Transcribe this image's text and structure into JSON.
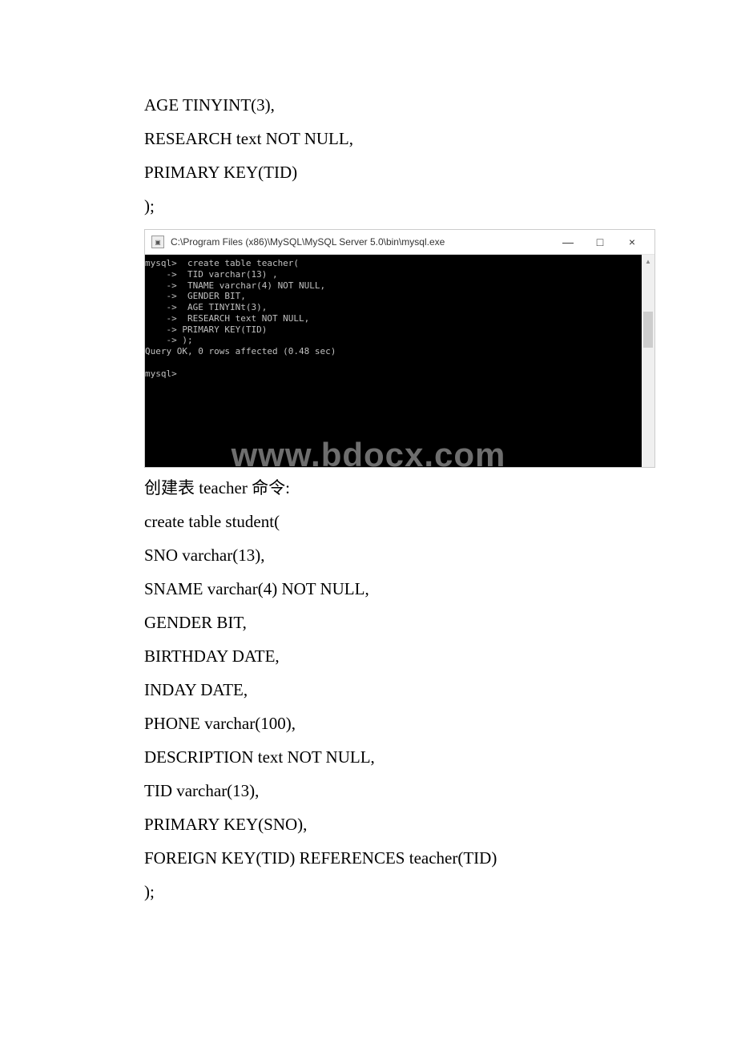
{
  "doc": {
    "top_lines": [
      "AGE TINYINT(3),",
      "RESEARCH text NOT NULL,",
      "PRIMARY KEY(TID)",
      ");"
    ],
    "caption": "创建表 teacher 命令:",
    "bottom_lines": [
      "create table student(",
      " SNO varchar(13),",
      " SNAME varchar(4) NOT NULL,",
      " GENDER BIT,",
      " BIRTHDAY DATE,",
      " INDAY DATE,",
      " PHONE varchar(100),",
      " DESCRIPTION text NOT NULL,",
      " TID varchar(13),",
      " PRIMARY KEY(SNO),",
      " FOREIGN KEY(TID) REFERENCES teacher(TID)",
      ");"
    ]
  },
  "terminal": {
    "title": "C:\\Program Files (x86)\\MySQL\\MySQL Server 5.0\\bin\\mysql.exe",
    "controls": {
      "minimize": "—",
      "maximize": "□",
      "close": "×"
    },
    "content": "mysql>  create table teacher(\n    ->  TID varchar(13) ,\n    ->  TNAME varchar(4) NOT NULL,\n    ->  GENDER BIT,\n    ->  AGE TINYINt(3),\n    ->  RESEARCH text NOT NULL,\n    -> PRIMARY KEY(TID)\n    -> );\nQuery OK, 0 rows affected (0.48 sec)\n\nmysql>\n\n\n\n\n\n\n\n\n"
  },
  "watermark": "www.bdocx.com"
}
